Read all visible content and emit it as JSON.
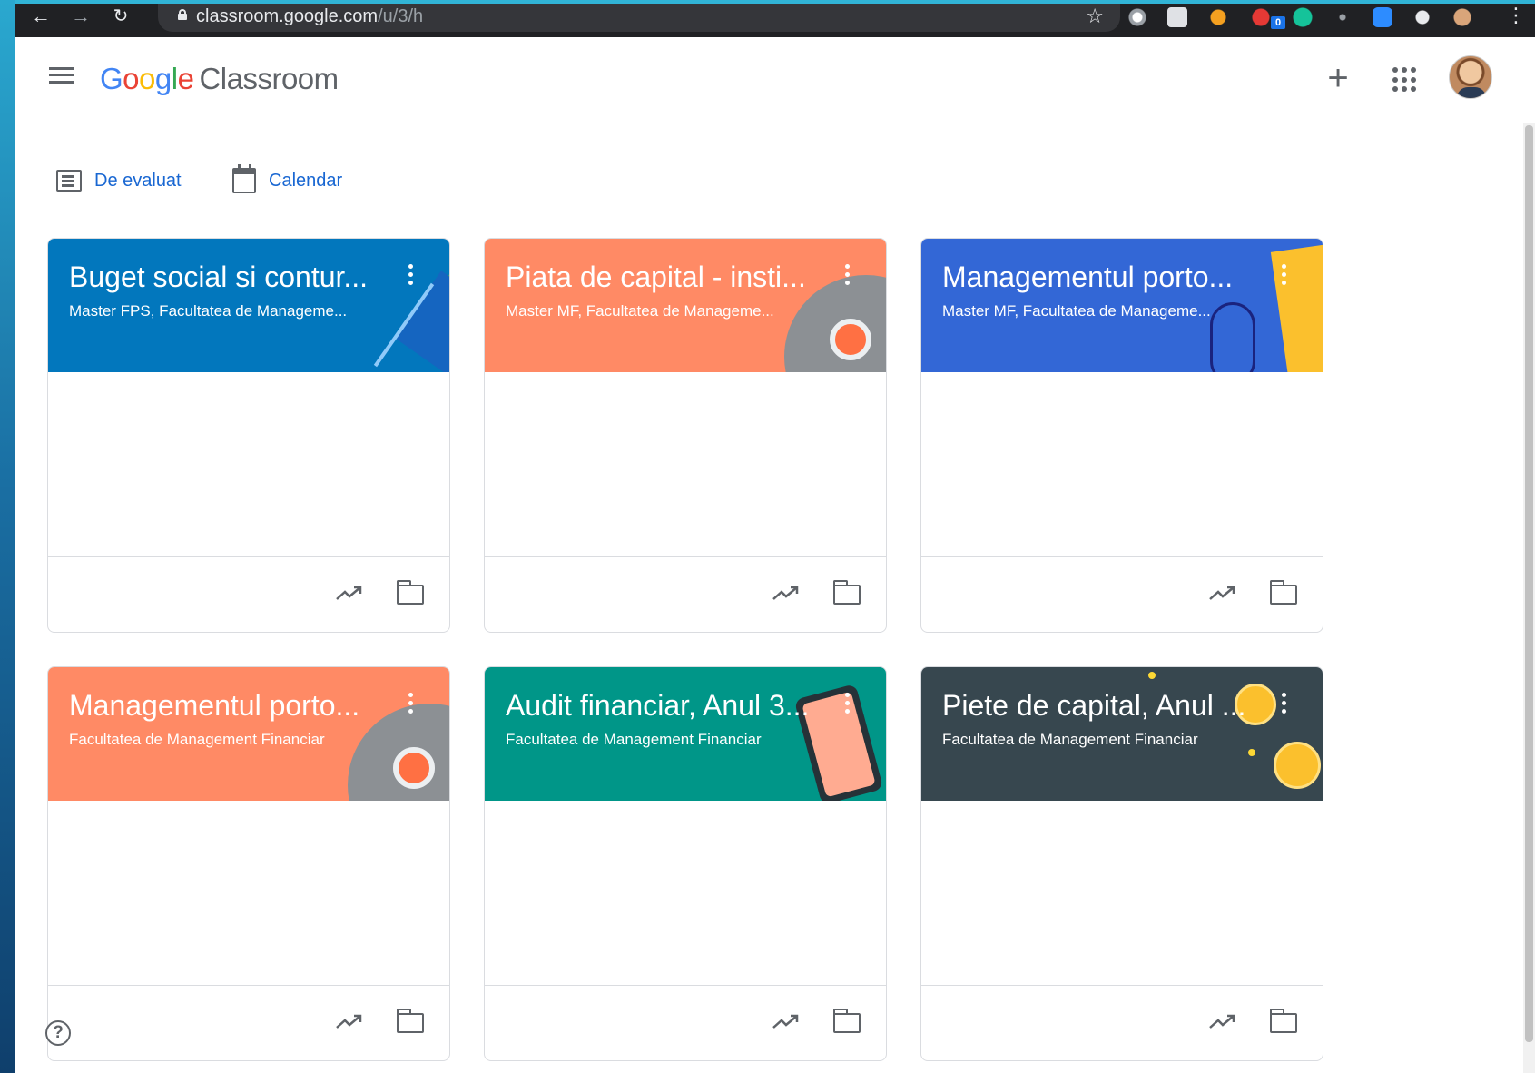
{
  "browser": {
    "url_host": "classroom.google.com",
    "url_path": "/u/3/h",
    "ext_badge": "0"
  },
  "app": {
    "logo_google": [
      "G",
      "o",
      "o",
      "g",
      "l",
      "e"
    ],
    "logo_product": "Classroom",
    "plus": "+"
  },
  "links": {
    "review": "De evaluat",
    "calendar": "Calendar"
  },
  "cards": [
    {
      "title": "Buget social si contur...",
      "subtitle": "Master FPS, Facultatea de Manageme...",
      "color": "#0277bd"
    },
    {
      "title": "Piata de capital - insti...",
      "subtitle": "Master MF, Facultatea de Manageme...",
      "color": "#ff8a65"
    },
    {
      "title": "Managementul porto...",
      "subtitle": "Master MF, Facultatea de Manageme...",
      "color": "#3367d6"
    },
    {
      "title": "Managementul porto...",
      "subtitle": "Facultatea de Management Financiar",
      "color": "#ff8a65"
    },
    {
      "title": "Audit financiar, Anul 3...",
      "subtitle": "Facultatea de Management Financiar",
      "color": "#009688"
    },
    {
      "title": "Piete de capital, Anul ...",
      "subtitle": "Facultatea de Management Financiar",
      "color": "#37474f"
    }
  ],
  "help": "?"
}
